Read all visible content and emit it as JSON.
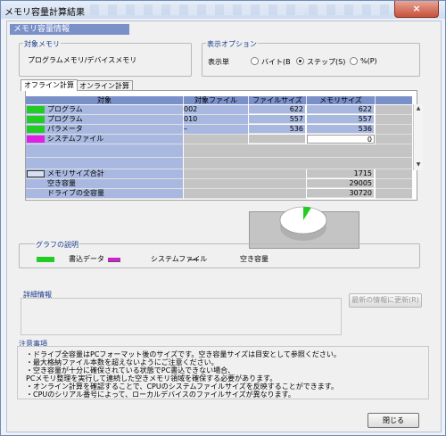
{
  "window": {
    "title": "メモリ容量計算結果",
    "close_glyph": "×"
  },
  "header": {
    "label": "メモリ容量情報"
  },
  "target_memory": {
    "title": "対象メモリ",
    "value": "プログラムメモリ/デバイスメモリ"
  },
  "display_options": {
    "title": "表示オプション",
    "unit_label": "表示単",
    "options": [
      {
        "label": "バイト(B",
        "selected": false
      },
      {
        "label": "ステップ(S)",
        "selected": true
      },
      {
        "label": "%(P)",
        "selected": false
      }
    ]
  },
  "tabs": [
    {
      "label": "オフライン計算",
      "active": true
    },
    {
      "label": "オンライン計算",
      "active": false
    }
  ],
  "table": {
    "headers": [
      "対象",
      "対象ファイル",
      "ファイルサイズ",
      "メモリサイズ"
    ],
    "rows": [
      {
        "name": "プログラム",
        "file": "002",
        "file_size": "622",
        "memory_size": "622",
        "swatch": "#22cc22"
      },
      {
        "name": "プログラム",
        "file": "010",
        "file_size": "557",
        "memory_size": "557",
        "swatch": "#22cc22"
      },
      {
        "name": "パラメータ",
        "file": "–",
        "file_size": "536",
        "memory_size": "536",
        "swatch": "#22cc22"
      },
      {
        "name": "システムファイル",
        "file": "",
        "file_size": "",
        "memory_size": "0",
        "swatch": "#e020e0"
      }
    ],
    "totals": [
      {
        "label": "メモリサイズ合計",
        "value": "1715"
      },
      {
        "label": "空き容量",
        "value": "29005"
      },
      {
        "label": "ドライブの全容量",
        "value": "30720"
      }
    ]
  },
  "pie": {
    "used_fraction": 0.0558,
    "used_color": "#22cc22"
  },
  "legend": {
    "title": "グラフの説明",
    "items": [
      {
        "label": "書込データ",
        "color": "#22cc22"
      },
      {
        "label": "システムファイル",
        "color": "#d020d0"
      },
      {
        "label": "空き容量",
        "color": ""
      }
    ]
  },
  "details": {
    "title": "詳細情報",
    "refresh_button": "最新の情報に更新(R)"
  },
  "notes": {
    "title": "注意事項",
    "lines": [
      "・ドライブ全容量はPCフォーマット後のサイズです。空き容量サイズは目安として参照ください。",
      "・最大格納ファイル本数を超えないようにご注意ください。",
      "・空き容量が十分に確保されている状態でPC書込できない場合、",
      "  PCメモリ整理を実行して連続した空きメモリ領域を確保する必要があります。",
      "・オンライン計算を確認することで、CPUのシステムファイルサイズを反映することができます。",
      "・CPUのシリアル番号によって、ローカルデバイスのファイルサイズが異なります。"
    ]
  },
  "close_button": "閉じる"
}
